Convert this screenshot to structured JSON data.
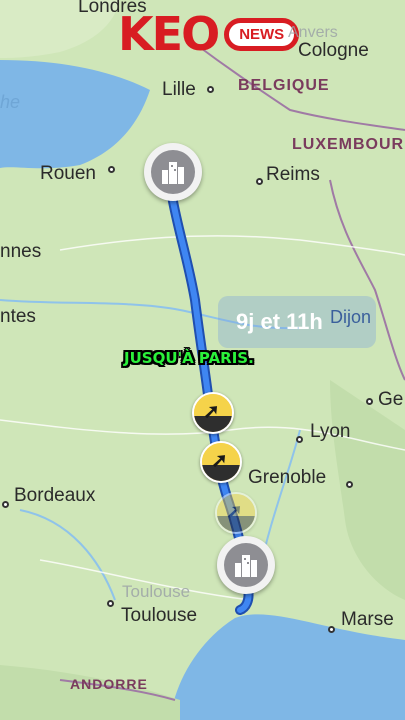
{
  "logo": {
    "main": "KEO",
    "badge": "NEWS"
  },
  "caption": "JUSQU'À PARIS.",
  "travel_badge": "9j et 11h",
  "labels": {
    "londres": "Londres",
    "anvers": "Anvers",
    "cologne": "Cologne",
    "lille": "Lille",
    "belgique": "BELGIQUE",
    "luxembourg": "LUXEMBOUR",
    "rouen": "Rouen",
    "reims": "Reims",
    "rennes": "nnes",
    "nantes": "ntes",
    "dijon": "Dijon",
    "lyon": "Lyon",
    "geneve": "Ge",
    "grenoble": "Grenoble",
    "bordeaux": "Bordeaux",
    "toulouse_faint": "Toulouse",
    "toulouse": "Toulouse",
    "marseille": "Marse",
    "andorre": "ANDORRE",
    "manche": "he"
  },
  "colors": {
    "route": "#2f6fe0",
    "land": "#cfe6b8",
    "sea": "#7fb7e6",
    "brand": "#d81c22",
    "caption": "#2bf03a"
  },
  "icons": [
    "city-icon",
    "exit-arrow-icon"
  ]
}
